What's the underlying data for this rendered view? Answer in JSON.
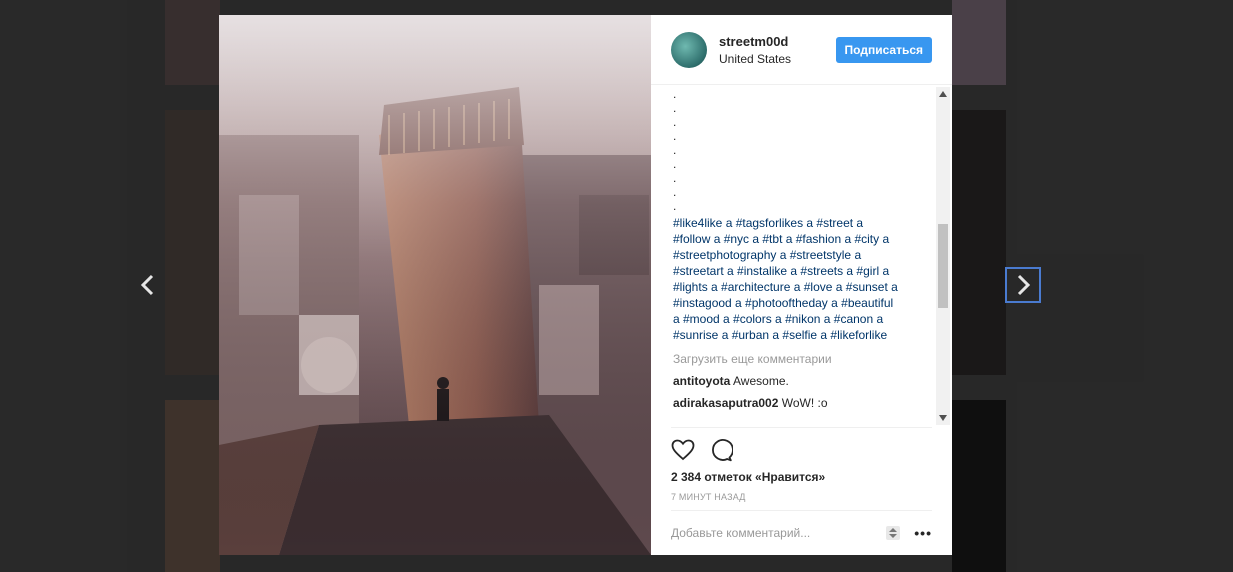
{
  "post": {
    "username": "streetm00d",
    "location": "United States",
    "follow_label": "Подписаться",
    "caption_dots": [
      ".",
      ".",
      ".",
      ".",
      ".",
      ".",
      ".",
      ".",
      "."
    ],
    "caption_lines": [
      "#like4like a #tagsforlikes a #street a",
      "#follow a #nyc a #tbt a #fashion a #city a",
      "#streetphotography a #streetstyle a",
      "#streetart a #instalike a #streets a #girl a",
      "#lights a #architecture a #love a #sunset a",
      "#instagood a #photooftheday a #beautiful",
      "a #mood a #colors a #nikon a #canon a",
      "#sunrise a #urban a #selfie a #likeforlike"
    ],
    "load_more": "Загрузить еще комментарии",
    "comments": [
      {
        "user": "antitoyota",
        "text": "Awesome."
      },
      {
        "user": "adirakasaputra002",
        "text": "WoW! :o"
      }
    ],
    "likes": "2 384 отметок «Нравится»",
    "time_ago": "7 МИНУТ НАЗАД",
    "comment_placeholder": "Добавьте комментарий...",
    "more_label": "•••"
  },
  "icons": {
    "prev": "chevron-left-icon",
    "next": "chevron-right-icon",
    "like": "heart-icon",
    "comment": "comment-bubble-icon"
  },
  "colors": {
    "follow_button": "#3897f0",
    "hashtag": "#003569",
    "muted": "#999999",
    "next_arrow_border": "#4a7bd0"
  }
}
